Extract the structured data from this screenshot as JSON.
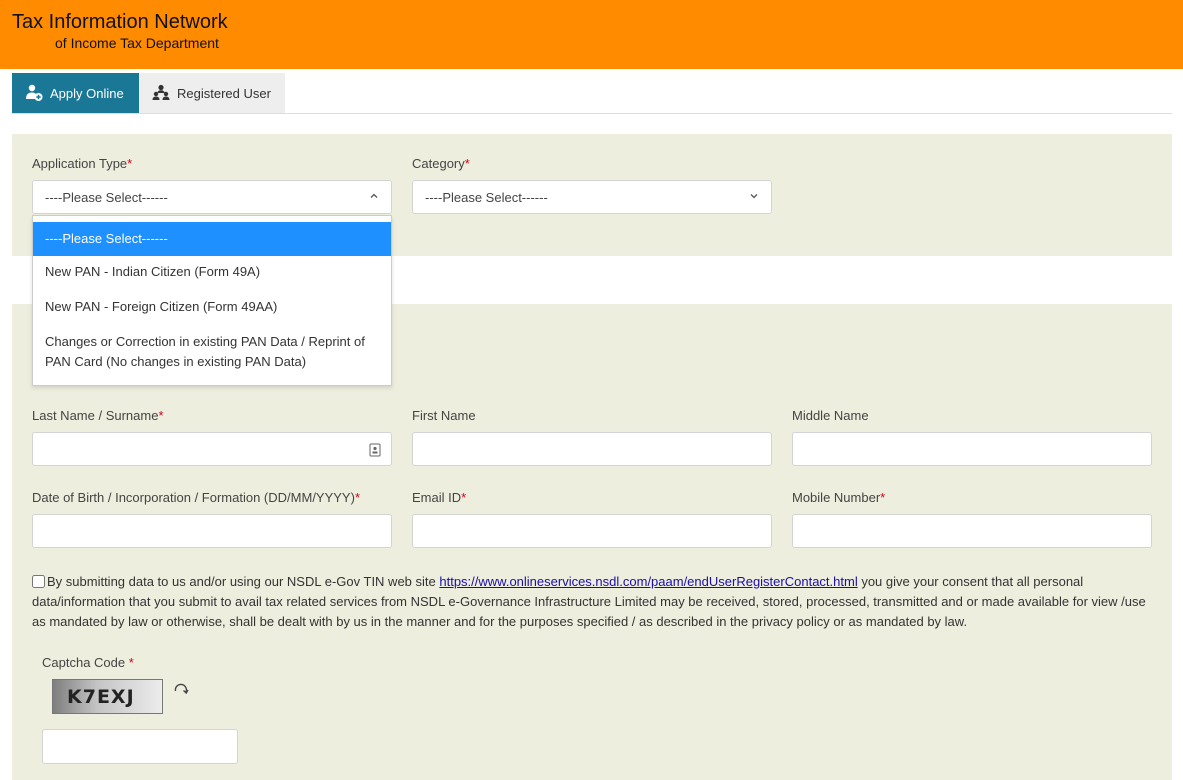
{
  "header": {
    "title": "Tax Information Network",
    "subtitle": "of Income Tax Department"
  },
  "tabs": [
    {
      "label": "Apply Online",
      "icon": "user-add-icon",
      "active": true
    },
    {
      "label": "Registered User",
      "icon": "users-icon",
      "active": false
    }
  ],
  "form": {
    "application_type": {
      "label": "Application Type",
      "required_mark": "*",
      "selected": "----Please Select------",
      "options": [
        "----Please Select------",
        "New PAN - Indian Citizen (Form 49A)",
        "New PAN - Foreign Citizen (Form 49AA)",
        "Changes or Correction in existing PAN Data / Reprint of",
        "PAN Card (No changes in existing PAN Data)"
      ]
    },
    "category": {
      "label": "Category",
      "required_mark": "*",
      "selected": "----Please Select------"
    },
    "last_name": {
      "label": "Last Name / Surname",
      "required_mark": "*",
      "value": ""
    },
    "first_name": {
      "label": "First Name",
      "value": ""
    },
    "middle_name": {
      "label": "Middle Name",
      "value": ""
    },
    "dob": {
      "label": "Date of Birth / Incorporation / Formation (DD/MM/YYYY)",
      "required_mark": "*",
      "value": ""
    },
    "email": {
      "label": "Email ID",
      "required_mark": "*",
      "value": ""
    },
    "mobile": {
      "label": "Mobile Number",
      "required_mark": "*",
      "value": ""
    }
  },
  "consent": {
    "checked": false,
    "text_before": "By submitting data to us and/or using our NSDL e-Gov TIN web site ",
    "link": "https://www.onlineservices.nsdl.com/paam/endUserRegisterContact.html",
    "text_after": " you give your consent that all personal data/information that you submit to avail tax related services from NSDL e-Governance Infrastructure Limited may be received, stored, processed, transmitted and or made available for view /use as mandated by law or otherwise, shall be dealt with by us in the manner and for the purposes specified / as described in the privacy policy or as mandated by law."
  },
  "captcha": {
    "label": "Captcha Code",
    "required_mark": "*",
    "code": "K7EXJ",
    "value": ""
  },
  "colors": {
    "header": "#ff8c00",
    "active_tab": "#1a7896",
    "panel": "#eeeedf",
    "selected_option": "#1e90ff"
  }
}
